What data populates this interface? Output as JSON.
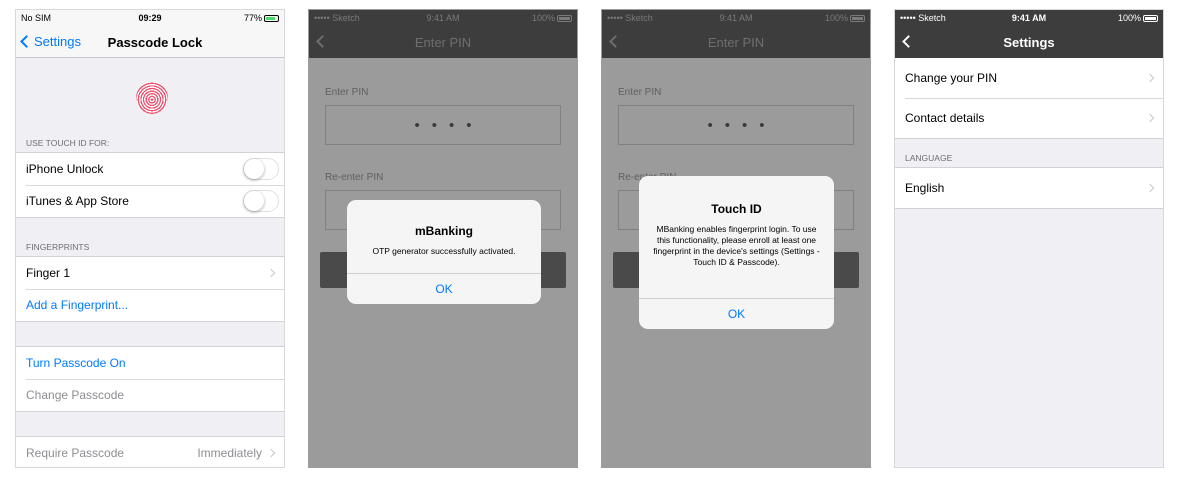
{
  "screen1": {
    "status": {
      "carrier": "No SIM",
      "time": "09:29",
      "battery": "77%"
    },
    "nav": {
      "back_label": "Settings",
      "title": "Passcode Lock"
    },
    "touch_id_header": "USE TOUCH ID FOR:",
    "touch_id_items": [
      {
        "label": "iPhone Unlock"
      },
      {
        "label": "iTunes & App Store"
      }
    ],
    "fingerprints_header": "FINGERPRINTS",
    "finger1": "Finger 1",
    "add_fingerprint": "Add a Fingerprint...",
    "turn_passcode_on": "Turn Passcode On",
    "change_passcode": "Change Passcode",
    "require_passcode": {
      "label": "Require Passcode",
      "value": "Immediately"
    }
  },
  "screen2": {
    "status": {
      "carrier": "••••• Sketch",
      "time": "9:41 AM",
      "battery": "100%"
    },
    "nav_title": "Enter PIN",
    "pin_label": "Enter PIN",
    "pin_dots": "••••",
    "reenter_label": "Re-enter PIN",
    "alert": {
      "title": "mBanking",
      "message": "OTP generator successfully activated.",
      "button": "OK"
    }
  },
  "screen3": {
    "status": {
      "carrier": "••••• Sketch",
      "time": "9:41 AM",
      "battery": "100%"
    },
    "nav_title": "Enter PIN",
    "pin_label": "Enter PIN",
    "pin_dots": "••••",
    "reenter_label": "Re-enter PIN",
    "alert": {
      "title": "Touch ID",
      "message": "MBanking enables fingerprint login. To use this functionality, please enroll at least one fingerprint in the device's settings (Settings - Touch ID & Passcode).",
      "button": "OK"
    }
  },
  "screen4": {
    "status": {
      "carrier": "••••• Sketch",
      "time": "9:41 AM",
      "battery": "100%"
    },
    "nav_title": "Settings",
    "items": [
      {
        "label": "Change your PIN"
      },
      {
        "label": "Contact details"
      }
    ],
    "language_header": "LANGUAGE",
    "language_value": "English"
  },
  "colors": {
    "ios_blue": "#007aff",
    "dark_bar": "#3d3d3d",
    "overlay_gray": "#9b9b9b"
  }
}
